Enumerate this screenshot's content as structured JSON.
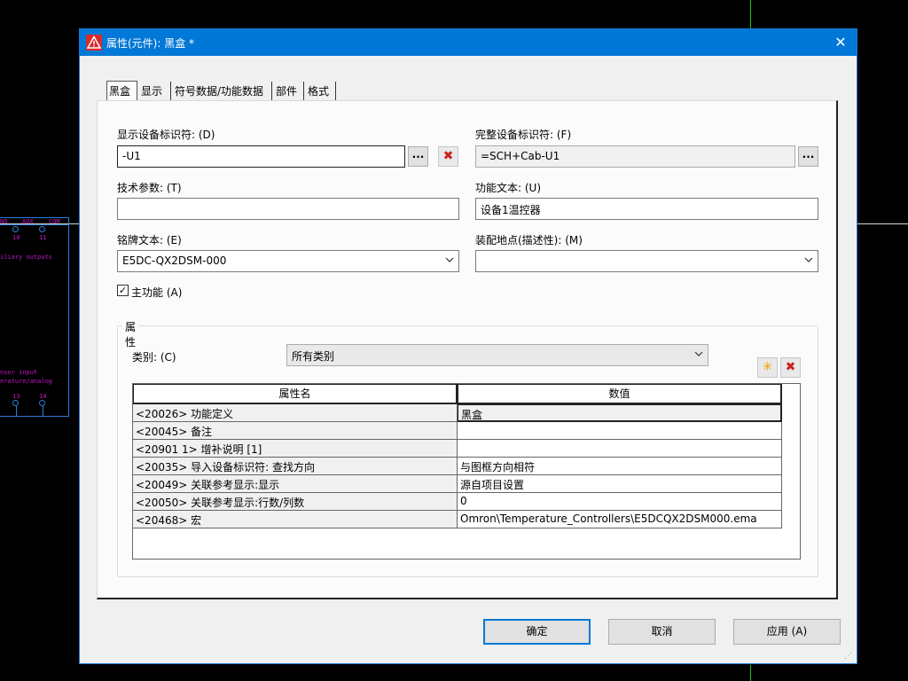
{
  "background": {
    "schematic_labels": [
      "NO",
      "AUX",
      "COM",
      "10",
      "11",
      "iliary outputs",
      "nsor input",
      "erature/analog",
      "13",
      "14"
    ]
  },
  "dialog": {
    "title": "属性(元件): 黑盒 *",
    "close_label": "✕",
    "tabs": [
      "黑盒",
      "显示",
      "符号数据/功能数据",
      "部件",
      "格式"
    ],
    "fields": {
      "display_dt_label": "显示设备标识符: (D)",
      "display_dt_value": "-U1",
      "full_dt_label": "完整设备标识符: (F)",
      "full_dt_value": "=SCH+Cab-U1",
      "tech_param_label": "技术参数: (T)",
      "tech_param_value": "",
      "func_text_label": "功能文本: (U)",
      "func_text_value": "设备1温控器",
      "nameplate_label": "铭牌文本: (E)",
      "nameplate_value": "E5DC-QX2DSM-000",
      "mount_label": "装配地点(描述性): (M)",
      "mount_value": "",
      "main_function_label": "主功能 (A)",
      "main_function_checked": true,
      "ellipsis": "...",
      "clear_icon": "✖"
    },
    "properties": {
      "group_title": "属性",
      "category_label": "类别: (C)",
      "category_value": "所有类别",
      "new_icon": "✳",
      "delete_icon": "✖",
      "columns": [
        "属性名",
        "数值"
      ],
      "rows": [
        {
          "name": "<20026> 功能定义",
          "value": "黑盒"
        },
        {
          "name": "<20045> 备注",
          "value": ""
        },
        {
          "name": "<20901 1> 增补说明 [1]",
          "value": ""
        },
        {
          "name": "<20035> 导入设备标识符: 查找方向",
          "value": "与图框方向相符"
        },
        {
          "name": "<20049> 关联参考显示:显示",
          "value": "源自项目设置"
        },
        {
          "name": "<20050> 关联参考显示:行数/列数",
          "value": "0"
        },
        {
          "name": "<20468> 宏",
          "value": "Omron\\Temperature_Controllers\\E5DCQX2DSM000.ema"
        }
      ]
    },
    "buttons": {
      "ok": "确定",
      "cancel": "取消",
      "apply": "应用 (A)"
    }
  },
  "colors": {
    "titlebar": "#0078d7",
    "background": "#000000",
    "schematic_line": "#2a7fd4",
    "schematic_text": "#c316c3",
    "crosshair": "#19c219"
  }
}
